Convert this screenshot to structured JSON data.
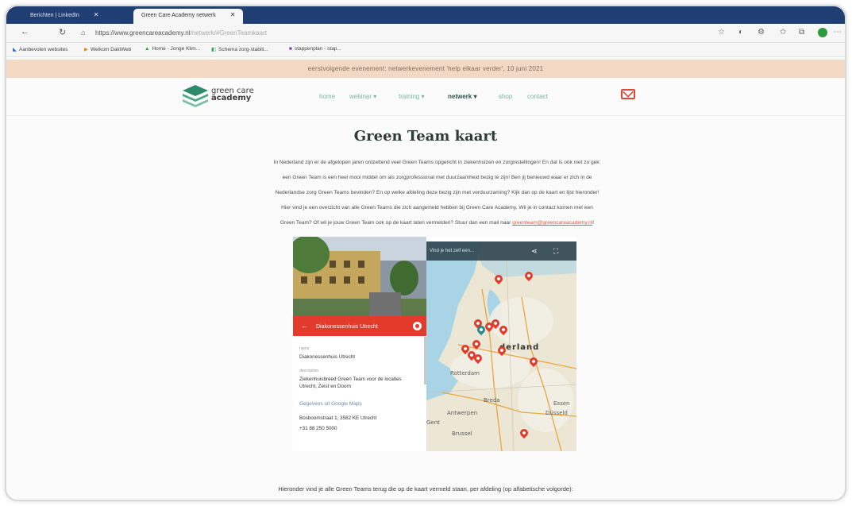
{
  "browser": {
    "tabs": [
      {
        "label": "Berichten | LinkedIn",
        "active": false
      },
      {
        "label": "Green Care Academy netwerk",
        "active": true
      }
    ],
    "url_main": "https://www.greencareacademy.nl",
    "url_path": "/netwerk/#GreenTeamkaart",
    "bookmarks": [
      "Aanbevolen websites",
      "Welkom DakiWeb",
      "Home - Jonge Klim...",
      "Schema zorg-stabili...",
      "stappenplan - stap..."
    ]
  },
  "announcement": "eerstvolgende evenement: netwerkevenement 'help elkaar verder', 10 juni 2021",
  "site": {
    "logo_line1": "green care",
    "logo_line2": "academy",
    "menu": [
      {
        "label": "home"
      },
      {
        "label": "webinar ▾"
      },
      {
        "label": "training ▾"
      },
      {
        "label": "netwerk ▾"
      },
      {
        "label": "shop"
      },
      {
        "label": "contact"
      }
    ]
  },
  "page": {
    "title": "Green Team kaart",
    "intro_lines": [
      "In Nederland zijn er de afgelopen jaren ontzettend veel Green Teams opgericht in ziekenhuizen en zorginstellingen! En dat is ook niet zo gek:",
      "een Green Team is een heel mooi middel om als zorgprofessional met duurzaamheid bezig te zijn! Ben jij benieuwd waar er zich in de",
      "Nederlandse zorg Green Teams bevinden? En op welke afdeling deze bezig zijn met verduurzaming? Kijk dan op de kaart en lijst hieronder!",
      "Hier vind je een overzicht van alle Green Teams die zich aangemeld hebben bij Green Care Academy. Wil je in contact komen met een"
    ],
    "intro_last_prefix": "Green Team? Of wil je jouw Green Team ook op de kaart laten vermelden? Stuur dan een mail naar ",
    "intro_email": "greenteam@greencareacademy.nl",
    "intro_last_suffix": "!",
    "bottom_text": "Hieronder vind je alle Green Teams terug die op de kaart vermeld staan, per afdeling (op alfabetische volgorde):"
  },
  "map_embed": {
    "selected_place": "Diakonessenhuis Utrecht",
    "name_label": "name",
    "name_value": "Diakonessenhuis Utrecht",
    "description_label": "description",
    "description_value": "Ziekenhuisbreed Green Team voor de locaties Utrecht, Zeist en Doorn",
    "google_section": "Gegevens uit Google Maps",
    "address": "Bosboomstraat 1, 3582 KE Utrecht",
    "phone": "+31 88 250 5000",
    "map_bar_text": "Vind je het zelf een...",
    "map_labels": {
      "country": "derland",
      "rotterdam": "Rotterdam",
      "antwerpen": "Antwerpen",
      "gent": "Gent",
      "brussel": "Brussel",
      "breda": "Breda",
      "essen": "Essen",
      "dusseldorf": "Düsseld"
    },
    "colors": {
      "marker": "#e23b2c",
      "selected_marker": "#2a8a8a",
      "header_red": "#e23b2c"
    }
  }
}
